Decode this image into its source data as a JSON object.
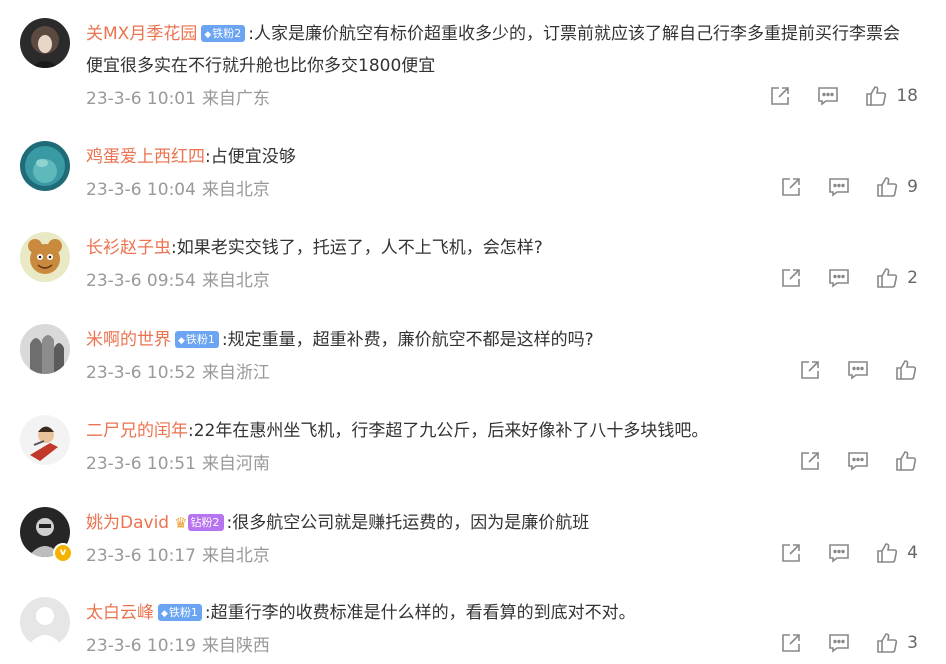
{
  "comments": [
    {
      "user": "关MX月季花园",
      "badge": "铁粉2",
      "badge_type": "iron",
      "separator": ":",
      "text": "人家是廉价航空有标价超重收多少的，订票前就应该了解自己行李多重提前买行李票会便宜很多实在不行就升舱也比你多交1800便宜",
      "time": "23-3-6 10:01",
      "location": "来自广东",
      "likes": "18"
    },
    {
      "user": "鸡蛋爱上西红四",
      "badge": "",
      "separator": ":",
      "text": "占便宜没够",
      "time": "23-3-6 10:04",
      "location": "来自北京",
      "likes": "9"
    },
    {
      "user": "长衫赵子虫",
      "badge": "",
      "separator": ":",
      "text": "如果老实交钱了，托运了，人不上飞机，会怎样?",
      "time": "23-3-6 09:54",
      "location": "来自北京",
      "likes": "2"
    },
    {
      "user": "米啊的世界",
      "badge": "铁粉1",
      "badge_type": "iron",
      "separator": ":",
      "text": "规定重量，超重补费，廉价航空不都是这样的吗?",
      "time": "23-3-6 10:52",
      "location": "来自浙江",
      "likes": ""
    },
    {
      "user": "二尸兄的闰年",
      "badge": "",
      "separator": ":",
      "text": "22年在惠州坐飞机，行李超了九公斤，后来好像补了八十多块钱吧。",
      "time": "23-3-6 10:51",
      "location": "来自河南",
      "likes": ""
    },
    {
      "user": "姚为David",
      "badge": "钻粉2",
      "badge_type": "drill",
      "separator": ":",
      "text": "很多航空公司就是赚托运费的，因为是廉价航班",
      "time": "23-3-6 10:17",
      "location": "来自北京",
      "likes": "4"
    },
    {
      "user": "太白云峰",
      "badge": "铁粉1",
      "badge_type": "iron",
      "separator": ":",
      "text": "超重行李的收费标准是什么样的，看看算的到底对不对。",
      "time": "23-3-6 10:19",
      "location": "来自陕西",
      "likes": "3"
    }
  ],
  "icons": {
    "share": "share-icon",
    "comment": "comment-icon",
    "like": "like-icon",
    "badge_gem": "diamond-icon",
    "crown": "crown-icon",
    "verified": "verified-icon"
  },
  "colors": {
    "username": "#eb7350",
    "meta": "#999999",
    "iron_badge": "#6ba4f2",
    "drill_badge": "#b774f0"
  }
}
